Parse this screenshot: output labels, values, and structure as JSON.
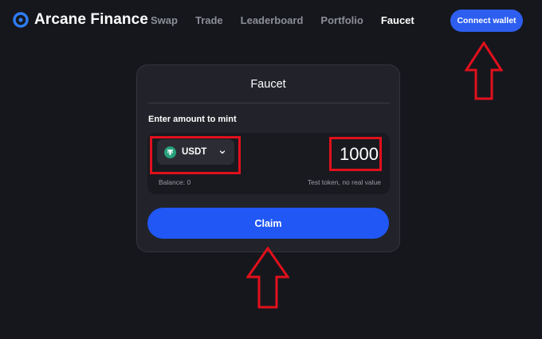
{
  "header": {
    "brand": "Arcane Finance",
    "nav": [
      {
        "label": "Swap",
        "active": false
      },
      {
        "label": "Trade",
        "active": false
      },
      {
        "label": "Leaderboard",
        "active": false
      },
      {
        "label": "Portfolio",
        "active": false
      },
      {
        "label": "Faucet",
        "active": true
      }
    ],
    "connect_label": "Connect wallet"
  },
  "faucet": {
    "title": "Faucet",
    "amount_label": "Enter amount to mint",
    "token": {
      "symbol": "USDT",
      "icon": "tether-icon"
    },
    "amount": "1000",
    "balance": "Balance: 0",
    "note": "Test token, no real value",
    "claim_label": "Claim"
  },
  "colors": {
    "background": "#16171d",
    "card": "#22232a",
    "accent": "#2057f5",
    "connect": "#2d5ef0",
    "annotation": "#e0101c",
    "tether": "#26a17b"
  }
}
